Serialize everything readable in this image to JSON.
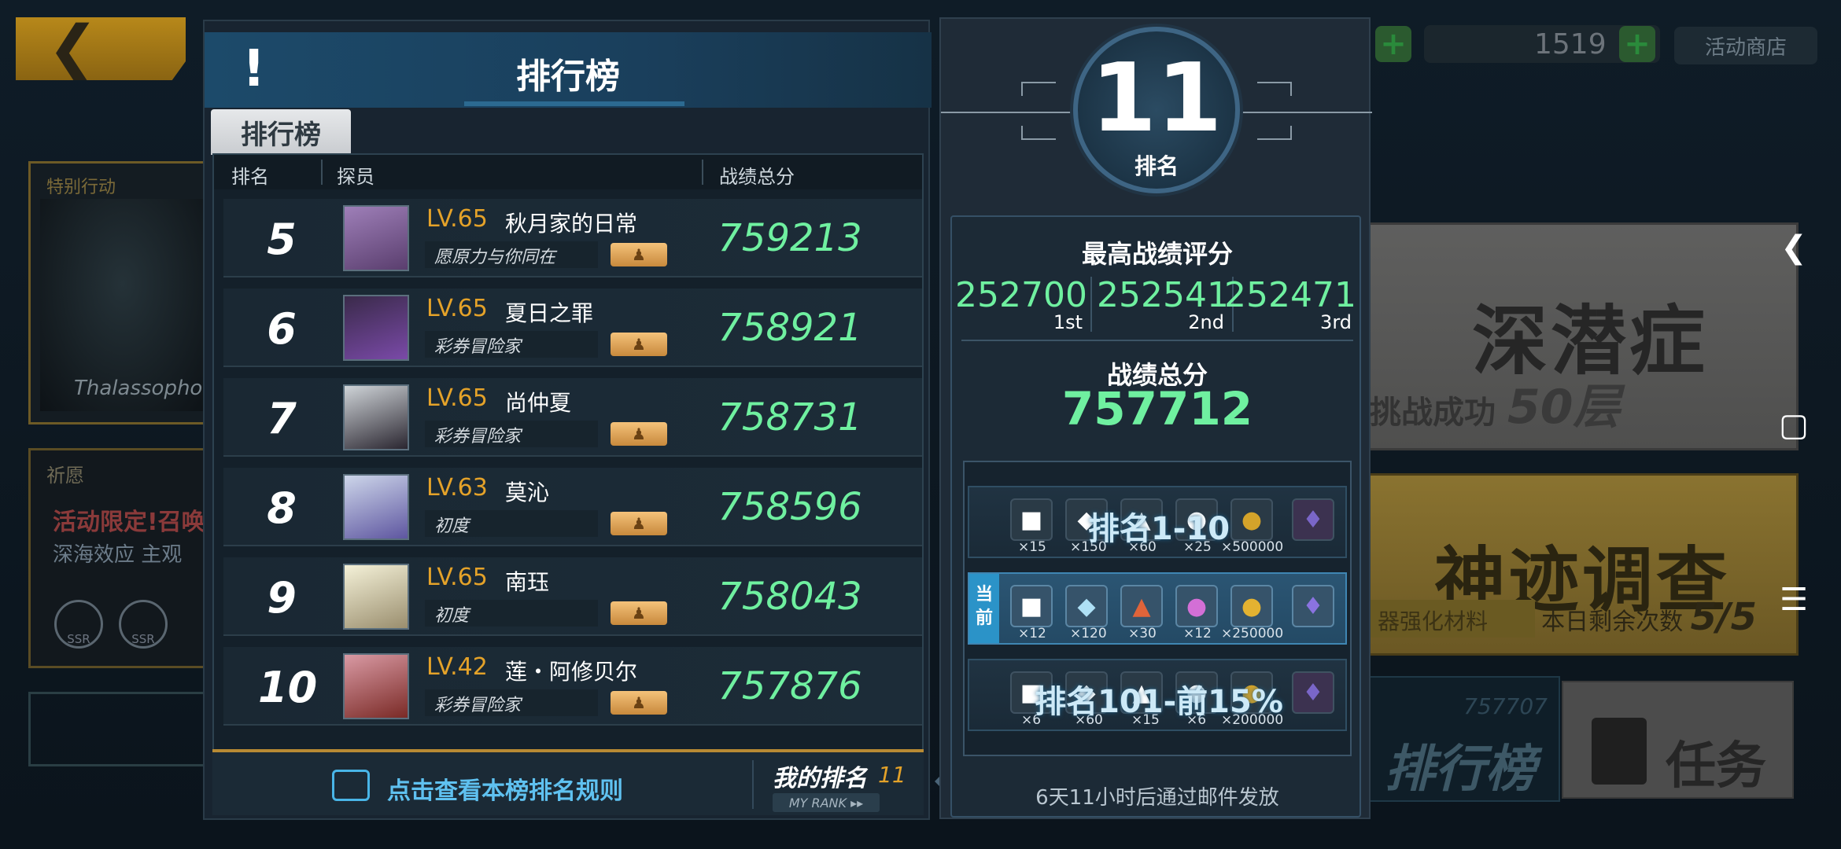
{
  "background": {
    "card1_title": "特别行动",
    "card1_sub": "Thalassophob",
    "card2_title": "祈愿",
    "card2_promo": "活动限定!召唤",
    "card2_desc": "深海效应 主观",
    "ssr_label": "SSR",
    "currency_value": "1519",
    "shop_label": "活动商店",
    "event1_title": "深潜症",
    "event1_status": "挑战成功",
    "event1_floor": "50层",
    "event2_title": "神迹调查",
    "event2_sub": "器强化材料",
    "event2_remaining_label": "本日剩余次数",
    "event2_remaining": "5/5",
    "rank_btn_score": "757707",
    "rank_btn_label": "排行榜",
    "task_btn_label": "任务"
  },
  "leaderboard": {
    "title": "排行榜",
    "tab": "排行榜",
    "columns": {
      "rank": "排名",
      "agent": "探员",
      "score": "战绩总分"
    },
    "rows": [
      {
        "rank": "5",
        "level": "LV.65",
        "name": "秋月家的日常",
        "title": "愿原力与你同在",
        "score": "759213"
      },
      {
        "rank": "6",
        "level": "LV.65",
        "name": "夏日之罪",
        "title": "彩券冒险家",
        "score": "758921"
      },
      {
        "rank": "7",
        "level": "LV.65",
        "name": "尚仲夏",
        "title": "彩券冒险家",
        "score": "758731"
      },
      {
        "rank": "8",
        "level": "LV.63",
        "name": "莫沁",
        "title": "初度",
        "score": "758596"
      },
      {
        "rank": "9",
        "level": "LV.65",
        "name": "南珏",
        "title": "初度",
        "score": "758043"
      },
      {
        "rank": "10",
        "level": "LV.42",
        "name": "莲・阿修贝尔",
        "title": "彩券冒险家",
        "score": "757876"
      }
    ],
    "rules_link": "点击查看本榜排名规则",
    "my_rank_label": "我的排名",
    "my_rank_value": "11",
    "my_rank_en": "MY RANK ▸▸"
  },
  "detail": {
    "rank_value": "11",
    "rank_label": "排名",
    "best_title": "最高战绩评分",
    "best": [
      {
        "score": "252700",
        "ord": "1st"
      },
      {
        "score": "252541",
        "ord": "2nd"
      },
      {
        "score": "252471",
        "ord": "3rd"
      }
    ],
    "total_title": "战绩总分",
    "total_value": "757712",
    "current_tag": "当前",
    "tiers": [
      {
        "label": "排名1-10",
        "qty": [
          "×15",
          "×150",
          "×60",
          "×25",
          "×500000",
          ""
        ]
      },
      {
        "label": "",
        "qty": [
          "×12",
          "×120",
          "×30",
          "×12",
          "×250000",
          ""
        ]
      },
      {
        "label": "排名101-前15%",
        "qty": [
          "×6",
          "×60",
          "×15",
          "×6",
          "×200000",
          ""
        ]
      }
    ],
    "mail_note": "6天11小时后通过邮件发放"
  },
  "colors": {
    "score_green": "#6ff0a0",
    "level_orange": "#e4a229",
    "rules_blue": "#5fc1f0"
  }
}
